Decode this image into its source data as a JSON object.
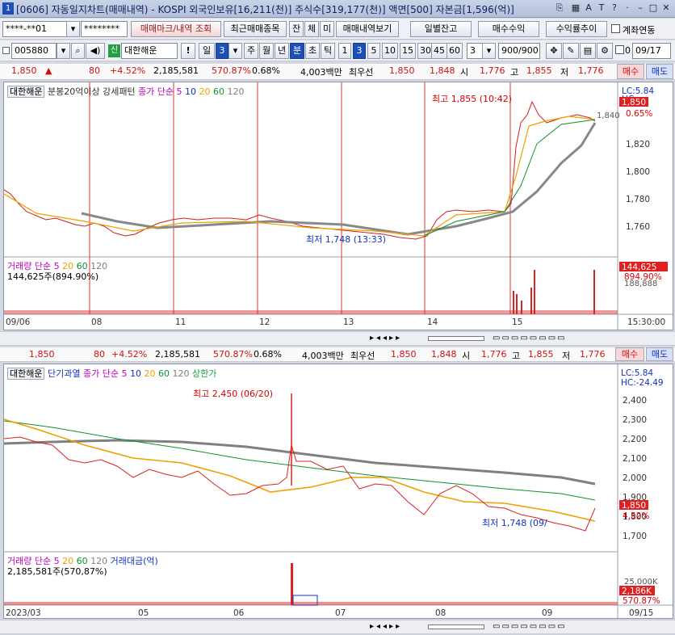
{
  "window": {
    "title": "[0606] 자동일지차트(매매내역) - KOSPI 외국인보유[16,211(천)] 주식수[319,177(천)] 액면[500] 자본금[1,596(억)]",
    "num": "1"
  },
  "toolbar1": {
    "account": "****-**01",
    "password": "********",
    "b1": "매매마크/내역 조회",
    "b2": "최근매매종목",
    "b3": "잔",
    "b4": "체",
    "b5": "미",
    "b6": "매매내역보기",
    "b7": "일별잔고",
    "b8": "매수수익",
    "b9": "수익률추이",
    "b10": "계좌연동"
  },
  "toolbar2": {
    "code": "005880",
    "sin": "신",
    "name": "대한해운",
    "excl": "!",
    "il": "일",
    "il_n": "3",
    "ju": "주",
    "wol": "월",
    "nyeon": "년",
    "bun": "분",
    "cho": "초",
    "tik": "틱",
    "n1": "1",
    "n3": "3",
    "n5": "5",
    "n10": "10",
    "n15": "15",
    "n30": "30",
    "n45": "45",
    "n60": "60",
    "n3b": "3",
    "count": "900/900",
    "date": "09/17",
    "chk": "0"
  },
  "quote": {
    "price": "1,850",
    "change": "80",
    "pct": "+4.52%",
    "vol": "2,185,581",
    "volpct": "570.87%",
    "turn": "0.68%",
    "amt": "4,003백만",
    "best": "최우선",
    "ask": "1,850",
    "bid": "1,848",
    "si_l": "시",
    "si": "1,776",
    "go_l": "고",
    "go": "1,855",
    "jeo_l": "저",
    "jeo": "1,776",
    "buy": "매수",
    "sell": "매도"
  },
  "chart1": {
    "name": "대한해운",
    "pattern": "분봉20억이상 강세패턴",
    "ma": "종가 단순 5",
    "m10": "10",
    "m20": "20",
    "m60": "60",
    "m120": "120",
    "high": "최고 1,855 (10:42)",
    "low": "최저 1,748 (13:33)",
    "lc": "LC:5.84",
    "hc": "HC:",
    "flag": "1,850",
    "pctflag": "0.65%",
    "ticks": [
      "1,840",
      "1,820",
      "1,800",
      "1,780",
      "1,760"
    ],
    "vol_leg": "거래량",
    "vol_ma": "단순 5",
    "v20": "20",
    "v60": "60",
    "v120": "120",
    "vol_val": "144,625주(894.90%)",
    "vol_flag": "144,625",
    "vol_flag2": "894.90%",
    "vol_tick": "188,888",
    "xlabels": [
      "09/06",
      "08",
      "11",
      "12",
      "13",
      "14",
      "15"
    ],
    "time": "15:30:00"
  },
  "chart2": {
    "name": "대한해운",
    "pattern": "단기과열",
    "ma": "종가 단순 5",
    "m10": "10",
    "m20": "20",
    "m60": "60",
    "m120": "120",
    "upper": "상한가",
    "high": "최고 2,450 (06/20)",
    "low": "최저 1,748 (09/",
    "lc": "LC:5.84",
    "hc": "HC:-24.49",
    "flag": "1,850",
    "pctflag": "4.52%",
    "ticks": [
      "2,400",
      "2,300",
      "2,200",
      "2,100",
      "2,000",
      "1,900",
      "1,800",
      "1,700"
    ],
    "vol_leg": "거래량",
    "vol_ma": "단순 5",
    "v20": "20",
    "v60": "60",
    "v120": "120",
    "amt_leg": "거래대금(억)",
    "vol_val": "2,185,581주(570,87%)",
    "vol_tick": "25,000K",
    "vol_flag": "2,186K",
    "vol_flag2": "570.87%",
    "xlabels": [
      "2023/03",
      "05",
      "06",
      "07",
      "08",
      "09"
    ],
    "date": "09/15"
  },
  "colors": {
    "red": "#d01010",
    "blue": "#1030c0",
    "ma5": "#c000c0",
    "ma20": "#f0a000",
    "ma60": "#109030",
    "ma120": "#808080"
  }
}
